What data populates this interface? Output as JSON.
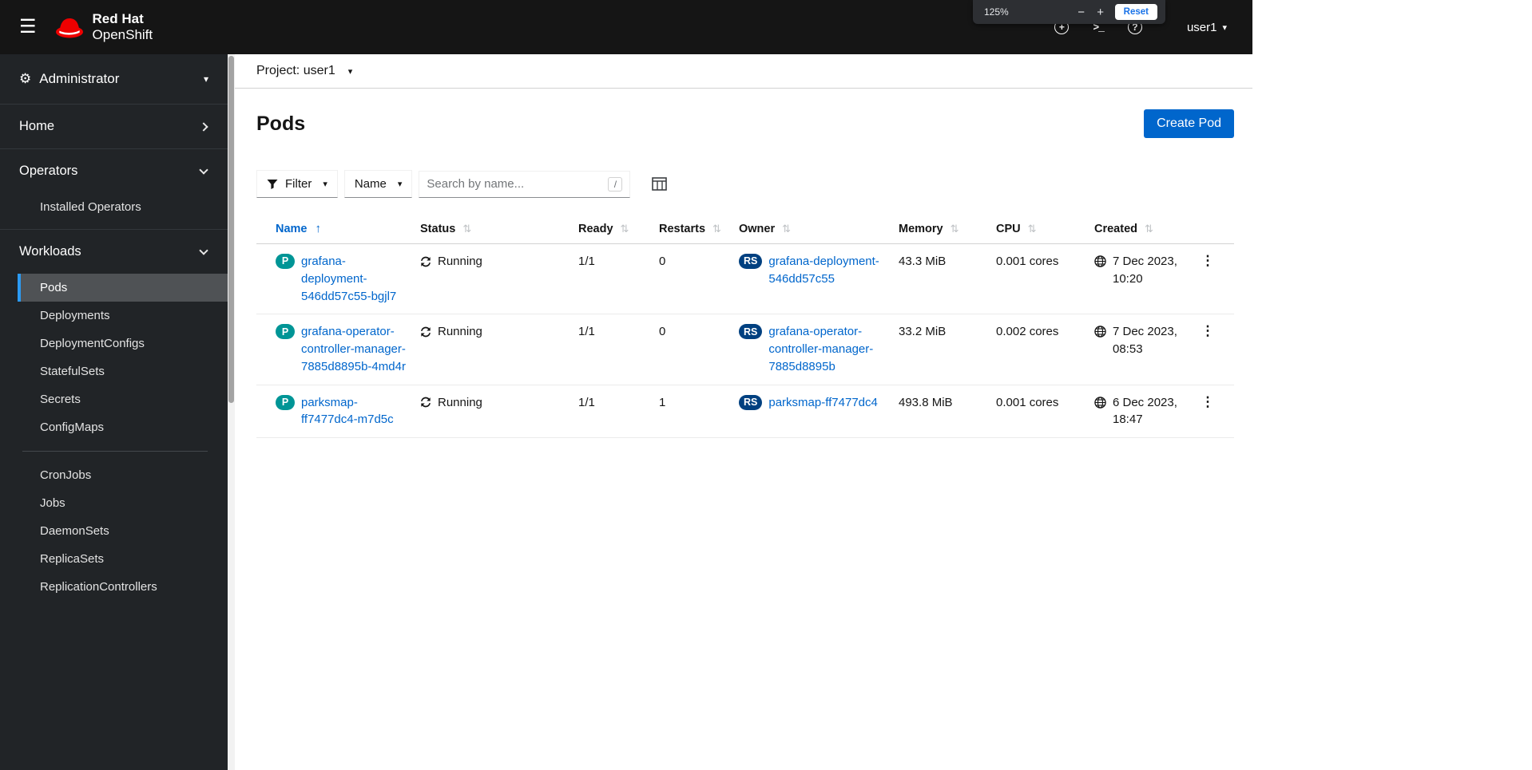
{
  "icons": {
    "hamburger": "☰",
    "gear": "⚙",
    "caret_down": "▾",
    "sort_ascending": "↑",
    "sort_inactive": "⇅",
    "kebab": "⋮",
    "zoom_minus": "−",
    "zoom_plus": "+",
    "plus_circle": "+",
    "terminal": ">_",
    "help": "?"
  },
  "colors": {
    "brand_red": "#ee0000",
    "link_blue": "#0066cc",
    "primary_button": "#0066cc",
    "pod_badge": "#009596",
    "replicaset_badge": "#004080",
    "masthead_bg": "#151515",
    "sidebar_bg": "#212427",
    "selected_nav_bg": "#4f5255",
    "selected_nav_indicator": "#2b9af3"
  },
  "browser_zoom": {
    "level": "125%",
    "reset_label": "Reset"
  },
  "masthead": {
    "brand_line1": "Red Hat",
    "brand_line2": "OpenShift",
    "user_menu": "user1"
  },
  "sidebar": {
    "perspective": "Administrator",
    "nav": {
      "home": "Home",
      "operators": "Operators",
      "operators_items": [
        "Installed Operators"
      ],
      "workloads": "Workloads",
      "workloads_items": [
        "Pods",
        "Deployments",
        "DeploymentConfigs",
        "StatefulSets",
        "Secrets",
        "ConfigMaps",
        "CronJobs",
        "Jobs",
        "DaemonSets",
        "ReplicaSets",
        "ReplicationControllers"
      ],
      "selected_item": "Pods"
    }
  },
  "project_bar": {
    "label": "Project: user1"
  },
  "page": {
    "title": "Pods",
    "create_button": "Create Pod"
  },
  "toolbar": {
    "filter_label": "Filter",
    "attribute_label": "Name",
    "search_placeholder": "Search by name...",
    "search_shortcut": "/"
  },
  "table": {
    "headers": {
      "name": "Name",
      "status": "Status",
      "ready": "Ready",
      "restarts": "Restarts",
      "owner": "Owner",
      "memory": "Memory",
      "cpu": "CPU",
      "created": "Created"
    },
    "pod_badge": "P",
    "replicaset_badge": "RS",
    "rows": [
      {
        "name": "grafana-deployment-546dd57c55-bgjl7",
        "status": "Running",
        "ready": "1/1",
        "restarts": "0",
        "owner": "grafana-deployment-546dd57c55",
        "memory": "43.3 MiB",
        "cpu": "0.001 cores",
        "created": "7 Dec 2023, 10:20"
      },
      {
        "name": "grafana-operator-controller-manager-7885d8895b-4md4r",
        "status": "Running",
        "ready": "1/1",
        "restarts": "0",
        "owner": "grafana-operator-controller-manager-7885d8895b",
        "memory": "33.2 MiB",
        "cpu": "0.002 cores",
        "created": "7 Dec 2023, 08:53"
      },
      {
        "name": "parksmap-ff7477dc4-m7d5c",
        "status": "Running",
        "ready": "1/1",
        "restarts": "1",
        "owner": "parksmap-ff7477dc4",
        "memory": "493.8 MiB",
        "cpu": "0.001 cores",
        "created": "6 Dec 2023, 18:47"
      }
    ]
  }
}
